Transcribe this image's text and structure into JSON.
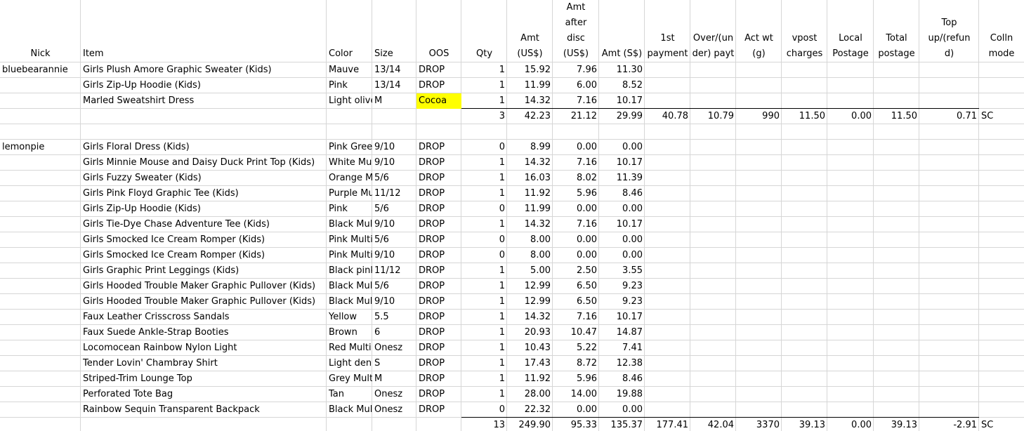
{
  "headers": {
    "nick": [
      "Nick"
    ],
    "item": [
      "Item"
    ],
    "color": [
      "Color"
    ],
    "size": [
      "Size"
    ],
    "oos": [
      "OOS"
    ],
    "qty": [
      "Qty"
    ],
    "amt": [
      "Amt",
      "(US$)"
    ],
    "amt_after_disc": [
      "Amt",
      "after",
      "disc",
      "(US$)"
    ],
    "amt_sgd": [
      "Amt (S$)"
    ],
    "first_payment": [
      "1st",
      "payment"
    ],
    "over_under": [
      "Over/(un",
      "der) payt"
    ],
    "act_wt": [
      "Act wt",
      "(g)"
    ],
    "vpost": [
      "vpost",
      "charges"
    ],
    "local_postage": [
      "Local",
      "Postage"
    ],
    "total_postage": [
      "Total",
      "postage"
    ],
    "top_up": [
      "Top",
      "up/(refun",
      "d)"
    ],
    "colln_mode": [
      "Colln",
      "mode"
    ]
  },
  "rows": [
    {
      "nick": "bluebearannie",
      "item": "Girls Plush Amore Graphic Sweater (Kids)",
      "color": "Mauve",
      "size": "13/14",
      "oos": "DROP",
      "qty": "1",
      "amt": "15.92",
      "disc": "7.96",
      "sgd": "11.30"
    },
    {
      "nick": "",
      "item": "Girls Zip-Up Hoodie (Kids)",
      "color": "Pink",
      "size": "13/14",
      "oos": "DROP",
      "qty": "1",
      "amt": "11.99",
      "disc": "6.00",
      "sgd": "8.52"
    },
    {
      "nick": "",
      "item": "Marled Sweatshirt Dress",
      "color": "Light olive",
      "size": "M",
      "oos": "Cocoa",
      "oos_highlight": true,
      "qty": "1",
      "amt": "14.32",
      "disc": "7.16",
      "sgd": "10.17"
    },
    {
      "total": true,
      "qty": "3",
      "amt": "42.23",
      "disc": "21.12",
      "sgd": "29.99",
      "first_payment": "40.78",
      "over_under": "10.79",
      "act_wt": "990",
      "vpost": "11.50",
      "local_postage": "0.00",
      "total_postage": "11.50",
      "top_up": "0.71",
      "colln_mode": "SC"
    },
    {
      "blank": true
    },
    {
      "nick": "lemonpie",
      "item": "Girls Floral Dress (Kids)",
      "color": "Pink Green",
      "size": "9/10",
      "oos": "DROP",
      "qty": "0",
      "amt": "8.99",
      "disc": "0.00",
      "sgd": "0.00"
    },
    {
      "nick": "",
      "item": "Girls Minnie Mouse and Daisy Duck Print Top (Kids)",
      "color": "White Multi",
      "size": "9/10",
      "oos": "DROP",
      "qty": "1",
      "amt": "14.32",
      "disc": "7.16",
      "sgd": "10.17"
    },
    {
      "nick": "",
      "item": "Girls Fuzzy Sweater (Kids)",
      "color": "Orange Multi",
      "size": "5/6",
      "oos": "DROP",
      "qty": "1",
      "amt": "16.03",
      "disc": "8.02",
      "sgd": "11.39"
    },
    {
      "nick": "",
      "item": "Girls Pink Floyd Graphic Tee (Kids)",
      "color": "Purple Multi",
      "size": "11/12",
      "oos": "DROP",
      "qty": "1",
      "amt": "11.92",
      "disc": "5.96",
      "sgd": "8.46"
    },
    {
      "nick": "",
      "item": "Girls Zip-Up Hoodie (Kids)",
      "color": "Pink",
      "size": "5/6",
      "oos": "DROP",
      "qty": "0",
      "amt": "11.99",
      "disc": "0.00",
      "sgd": "0.00"
    },
    {
      "nick": "",
      "item": "Girls Tie-Dye Chase Adventure Tee (Kids)",
      "color": "Black Multi",
      "size": "9/10",
      "oos": "DROP",
      "qty": "1",
      "amt": "14.32",
      "disc": "7.16",
      "sgd": "10.17"
    },
    {
      "nick": "",
      "item": "Girls Smocked Ice Cream Romper (Kids)",
      "color": "Pink Multi",
      "size": "5/6",
      "oos": "DROP",
      "qty": "0",
      "amt": "8.00",
      "disc": "0.00",
      "sgd": "0.00"
    },
    {
      "nick": "",
      "item": "Girls Smocked Ice Cream Romper (Kids)",
      "color": "Pink Multi",
      "size": "9/10",
      "oos": "DROP",
      "qty": "0",
      "amt": "8.00",
      "disc": "0.00",
      "sgd": "0.00"
    },
    {
      "nick": "",
      "item": "Girls Graphic Print Leggings (Kids)",
      "color": "Black pink",
      "size": "11/12",
      "oos": "DROP",
      "qty": "1",
      "amt": "5.00",
      "disc": "2.50",
      "sgd": "3.55"
    },
    {
      "nick": "",
      "item": "Girls Hooded Trouble Maker Graphic Pullover (Kids)",
      "color": "Black Multi",
      "size": "5/6",
      "oos": "DROP",
      "qty": "1",
      "amt": "12.99",
      "disc": "6.50",
      "sgd": "9.23"
    },
    {
      "nick": "",
      "item": "Girls Hooded Trouble Maker Graphic Pullover (Kids)",
      "color": "Black Multi",
      "size": "9/10",
      "oos": "DROP",
      "qty": "1",
      "amt": "12.99",
      "disc": "6.50",
      "sgd": "9.23"
    },
    {
      "nick": "",
      "item": "Faux Leather Crisscross Sandals",
      "color": "Yellow",
      "size": "5.5",
      "oos": "DROP",
      "qty": "1",
      "amt": "14.32",
      "disc": "7.16",
      "sgd": "10.17"
    },
    {
      "nick": "",
      "item": "Faux Suede Ankle-Strap Booties",
      "color": "Brown",
      "size": "6",
      "oos": "DROP",
      "qty": "1",
      "amt": "20.93",
      "disc": "10.47",
      "sgd": "14.87"
    },
    {
      "nick": "",
      "item": "Locomocean Rainbow Nylon Light",
      "color": "Red Multi",
      "size": "Onesz",
      "oos": "DROP",
      "qty": "1",
      "amt": "10.43",
      "disc": "5.22",
      "sgd": "7.41"
    },
    {
      "nick": "",
      "item": "Tender Lovin' Chambray Shirt",
      "color": "Light denim",
      "size": "S",
      "oos": "DROP",
      "qty": "1",
      "amt": "17.43",
      "disc": "8.72",
      "sgd": "12.38"
    },
    {
      "nick": "",
      "item": "Striped-Trim Lounge Top",
      "color": "Grey Multi",
      "size": "M",
      "oos": "DROP",
      "qty": "1",
      "amt": "11.92",
      "disc": "5.96",
      "sgd": "8.46"
    },
    {
      "nick": "",
      "item": "Perforated Tote Bag",
      "color": "Tan",
      "size": "Onesz",
      "oos": "DROP",
      "qty": "1",
      "amt": "28.00",
      "disc": "14.00",
      "sgd": "19.88"
    },
    {
      "nick": "",
      "item": "Rainbow Sequin Transparent Backpack",
      "color": "Black Multi",
      "size": "Onesz",
      "oos": "DROP",
      "qty": "0",
      "amt": "22.32",
      "disc": "0.00",
      "sgd": "0.00"
    },
    {
      "total": true,
      "qty": "13",
      "amt": "249.90",
      "disc": "95.33",
      "sgd": "135.37",
      "first_payment": "177.41",
      "over_under": "42.04",
      "act_wt": "3370",
      "vpost": "39.13",
      "local_postage": "0.00",
      "total_postage": "39.13",
      "top_up": "-2.91",
      "colln_mode": "SC"
    }
  ],
  "colors": {
    "gridline": "#d6d6d6",
    "highlight": "#ffff00",
    "total_border": "#000000"
  }
}
